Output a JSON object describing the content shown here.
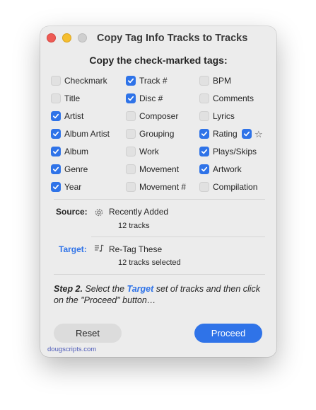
{
  "window": {
    "title": "Copy Tag Info Tracks to Tracks"
  },
  "heading": "Copy the check-marked tags:",
  "tags": {
    "col1": [
      {
        "label": "Checkmark",
        "checked": false
      },
      {
        "label": "Title",
        "checked": false
      },
      {
        "label": "Artist",
        "checked": true
      },
      {
        "label": "Album Artist",
        "checked": true
      },
      {
        "label": "Album",
        "checked": true
      },
      {
        "label": "Genre",
        "checked": true
      },
      {
        "label": "Year",
        "checked": true
      }
    ],
    "col2": [
      {
        "label": "Track #",
        "checked": true
      },
      {
        "label": "Disc #",
        "checked": true
      },
      {
        "label": "Composer",
        "checked": false
      },
      {
        "label": "Grouping",
        "checked": false
      },
      {
        "label": "Work",
        "checked": false
      },
      {
        "label": "Movement",
        "checked": false
      },
      {
        "label": "Movement #",
        "checked": false
      }
    ],
    "col3": [
      {
        "label": "BPM",
        "checked": false
      },
      {
        "label": "Comments",
        "checked": false
      },
      {
        "label": "Lyrics",
        "checked": false
      },
      {
        "label": "Rating",
        "checked": true
      },
      {
        "label": "Plays/Skips",
        "checked": true
      },
      {
        "label": "Artwork",
        "checked": true
      },
      {
        "label": "Compilation",
        "checked": false
      }
    ],
    "rating_extra": {
      "checked": true,
      "icon": "star-icon",
      "glyph": "☆"
    }
  },
  "source": {
    "label": "Source:",
    "icon": "gear-icon",
    "name": "Recently Added",
    "count": "12 tracks"
  },
  "target": {
    "label": "Target:",
    "icon": "music-list-icon",
    "name": "Re-Tag These",
    "count": "12 tracks selected"
  },
  "instructions": {
    "step": "Step 2.",
    "part1": " Select the ",
    "accent": "Target",
    "part2": " set of tracks and then click on the \"Proceed\" button…"
  },
  "buttons": {
    "reset": "Reset",
    "proceed": "Proceed"
  },
  "footer": "dougscripts.com",
  "colors": {
    "accent": "#2f73e8",
    "window_bg": "#ececec",
    "close": "#ee5b55",
    "minimize": "#f5be2f",
    "zoom": "#cfcfcf"
  }
}
